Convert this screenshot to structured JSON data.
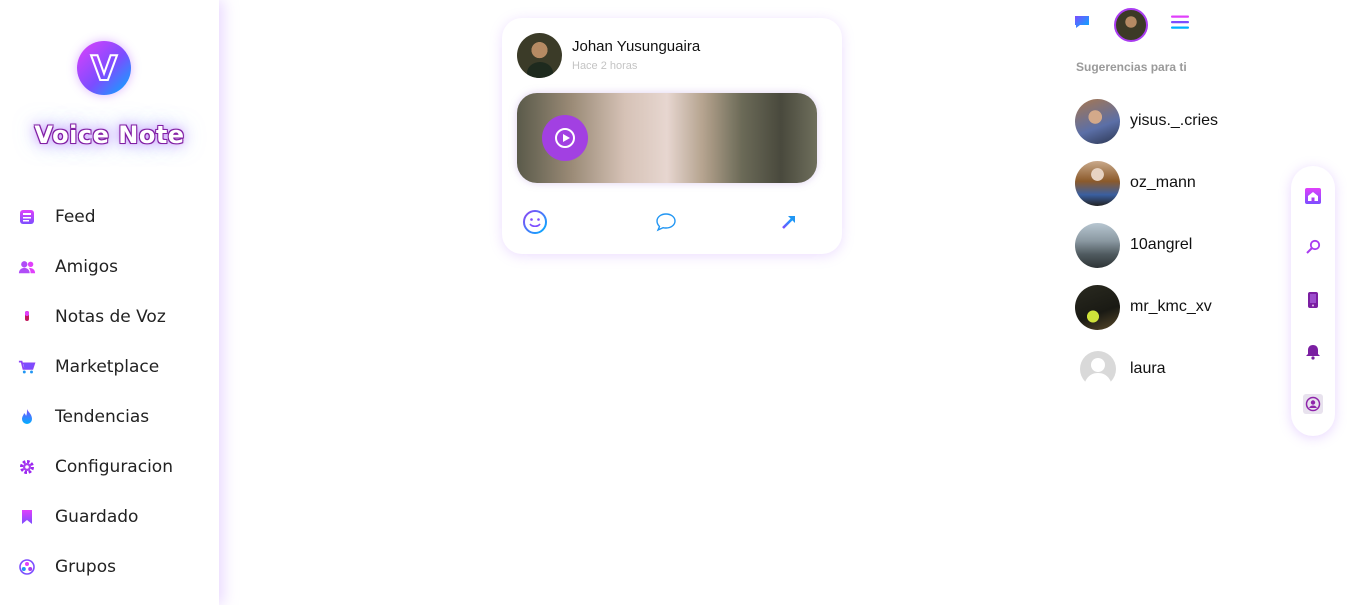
{
  "brand": {
    "name": "Voice Note",
    "logo_letter": "V",
    "logo_icon": "v-logo-icon"
  },
  "sidebar": {
    "items": [
      {
        "label": "Feed",
        "icon": "feed-icon"
      },
      {
        "label": "Amigos",
        "icon": "friends-icon"
      },
      {
        "label": "Notas de Voz",
        "icon": "microphone-icon"
      },
      {
        "label": "Marketplace",
        "icon": "cart-icon"
      },
      {
        "label": "Tendencias",
        "icon": "flame-icon"
      },
      {
        "label": "Configuracion",
        "icon": "gear-icon"
      },
      {
        "label": "Guardado",
        "icon": "bookmark-icon"
      },
      {
        "label": "Grupos",
        "icon": "groups-icon"
      }
    ]
  },
  "post": {
    "author": "Johan Yusunguaira",
    "time": "Hace 2 horas",
    "actions": [
      "emoji-icon",
      "comment-icon",
      "share-icon"
    ]
  },
  "topbar": {
    "icons": [
      "messages-icon",
      "profile-avatar",
      "menu-icon"
    ]
  },
  "suggestions": {
    "title": "Sugerencias para ti",
    "users": [
      {
        "name": "yisus._.cries"
      },
      {
        "name": "oz_mann"
      },
      {
        "name": "10angrel"
      },
      {
        "name": "mr_kmc_xv"
      },
      {
        "name": "laura"
      }
    ]
  },
  "float_nav": {
    "icons": [
      "home-icon",
      "search-icon",
      "phone-icon",
      "bell-icon",
      "user-icon"
    ]
  },
  "colors": {
    "accent": "#a93cf0",
    "pink": "#e040fb",
    "blue": "#00b0ff"
  }
}
